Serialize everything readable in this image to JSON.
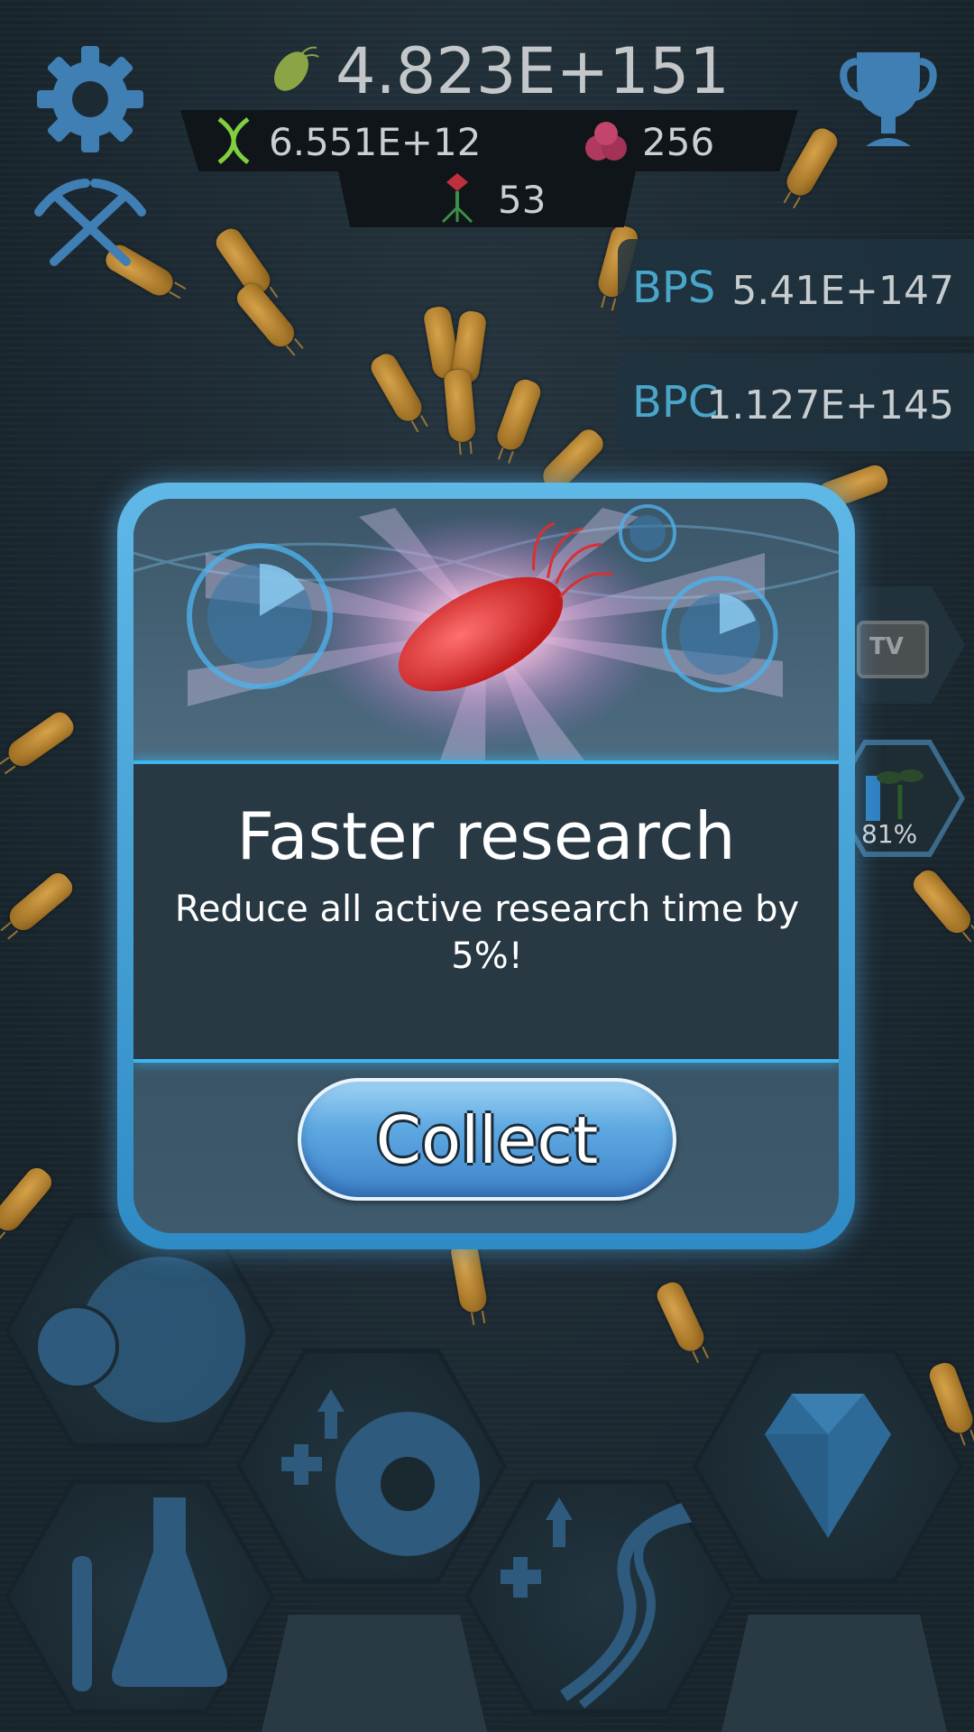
{
  "currency": {
    "main_value": "4.823E+151",
    "dna_value": "6.551E+12",
    "cells_value": "256",
    "phage_value": "53"
  },
  "stats": {
    "bps_label": "BPS",
    "bps_value": "5.41E+147",
    "bpc_label": "BPC",
    "bpc_value": "1.127E+145"
  },
  "side": {
    "tv_label": "TV",
    "growth_percent": "81%"
  },
  "modal": {
    "title": "Faster research",
    "description": "Reduce all active research time by 5%!",
    "collect_label": "Collect"
  },
  "icons": {
    "settings": "gear-icon",
    "mining": "pickaxes-icon",
    "trophy": "trophy-icon",
    "bacteria": "bacterium-icon",
    "dna": "dna-icon",
    "cells": "cells-icon",
    "phage": "phage-icon"
  },
  "colors": {
    "accent": "#3db5ef",
    "stat_label": "#4aa6c9",
    "button": "#5ea9e2"
  }
}
